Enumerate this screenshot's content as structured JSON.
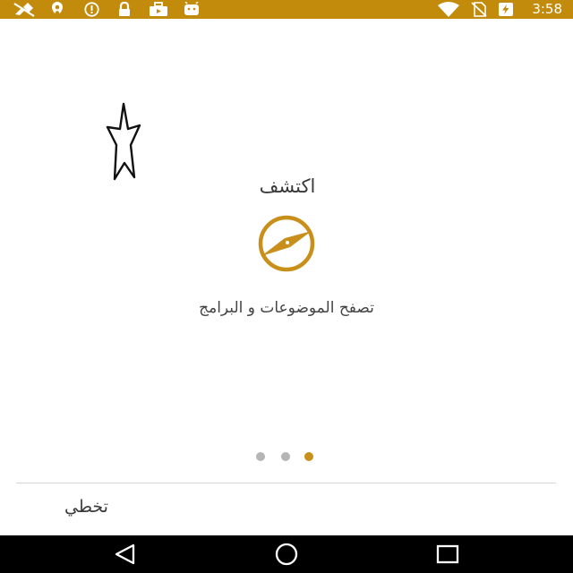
{
  "status_bar": {
    "time": "3:58",
    "background_color": "#c28b0b",
    "left_icons": [
      "no-signal-icon",
      "location-icon",
      "sync-icon",
      "lock-icon",
      "briefcase-icon",
      "android-icon"
    ],
    "right_icons": [
      "wifi-icon",
      "no-sim-icon",
      "battery-charging-icon"
    ]
  },
  "onboarding": {
    "title": "اكتشف",
    "subtitle": "تصفح الموضوعات و البرامج",
    "icon": "compass-icon",
    "accent_color": "#c8901a",
    "page_indicator": {
      "count": 3,
      "active_index": 2
    }
  },
  "footer": {
    "skip_label": "تخطي"
  },
  "nav_bar": {
    "buttons": [
      "back-icon",
      "home-icon",
      "recents-icon"
    ]
  }
}
